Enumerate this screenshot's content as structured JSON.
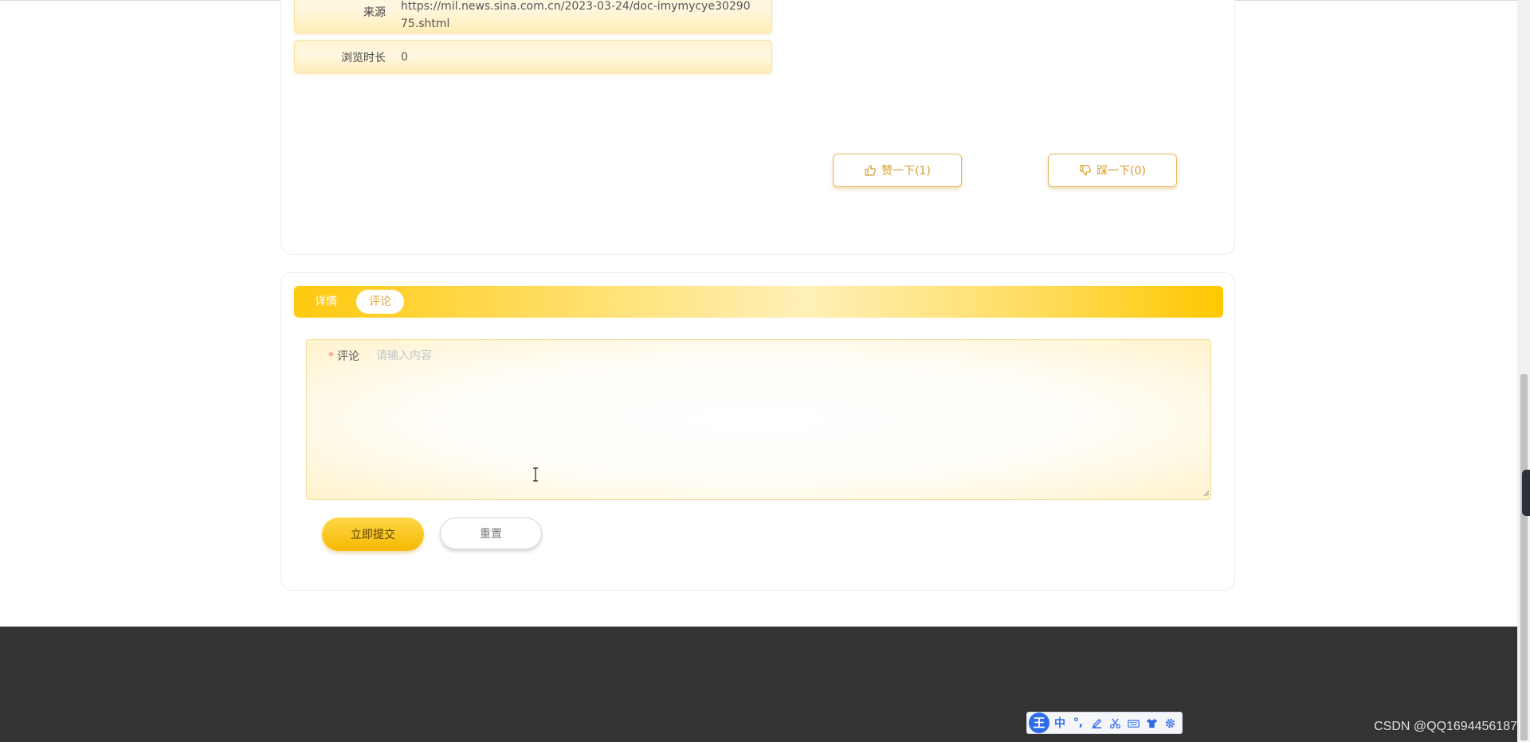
{
  "detail": {
    "source_label": "来源",
    "source_value": "https://mil.news.sina.com.cn/2023-03-24/doc-imymycye3029075.shtml",
    "views_label": "浏览时长",
    "views_value": "0"
  },
  "votes": {
    "like_label": "赞一下(1)",
    "dislike_label": "踩一下(0)"
  },
  "tabs": [
    {
      "label": "详情",
      "active": false
    },
    {
      "label": "评论",
      "active": true
    }
  ],
  "comment_form": {
    "required_mark": "*",
    "label": "评论",
    "placeholder": "请输入内容",
    "value": "",
    "submit_label": "立即提交",
    "reset_label": "重置"
  },
  "ime_toolbar": {
    "logo": "王",
    "mode": "中",
    "punct": "°,",
    "icons": [
      "pen-icon",
      "scissors-icon",
      "keyboard-icon",
      "shirt-icon",
      "gear-icon"
    ]
  },
  "watermark": "CSDN @QQ1694456187",
  "colors": {
    "accent": "#ffc90e",
    "accent_text": "#d99b2b",
    "footer": "#333333",
    "ime_blue": "#2f6de8"
  }
}
